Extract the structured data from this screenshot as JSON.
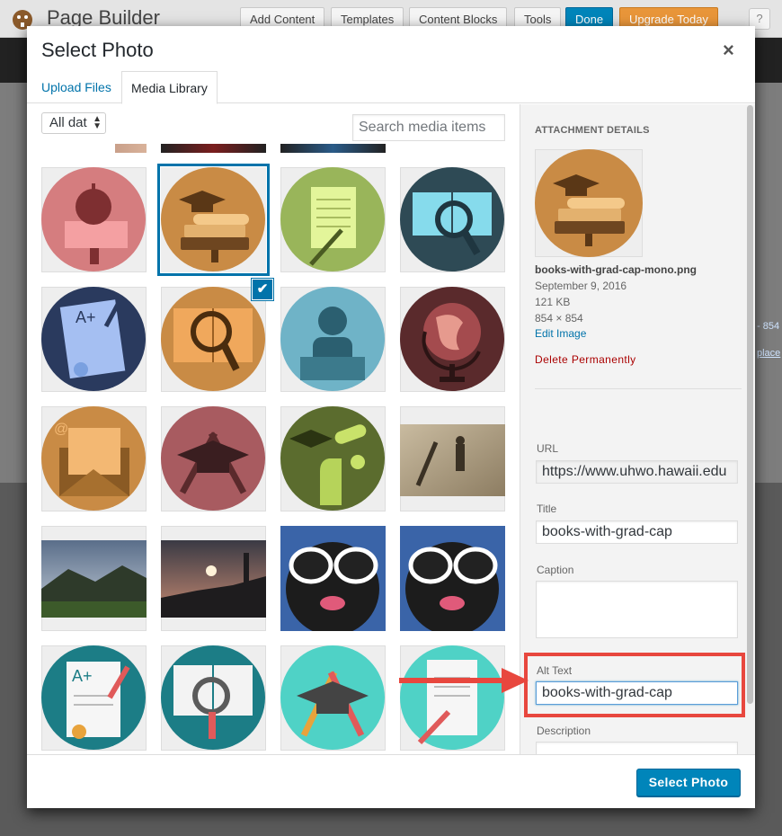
{
  "page_builder": {
    "title": "Page Builder",
    "buttons": [
      "Add Content",
      "Templates",
      "Content Blocks",
      "Tools",
      "Done",
      "Upgrade Today"
    ],
    "help": "?"
  },
  "background": {
    "right_text_1": "- 854",
    "right_text_2": "place"
  },
  "modal": {
    "title": "Select Photo",
    "close": "×",
    "tabs": {
      "upload": "Upload Files",
      "library": "Media Library"
    }
  },
  "toolbar": {
    "date_filter": "All dat",
    "search_placeholder": "Search media items"
  },
  "media_items": [
    {
      "name": "apple-books",
      "selected": false
    },
    {
      "name": "books-with-grad-cap-mono",
      "selected": true
    },
    {
      "name": "paper-pencil",
      "selected": false
    },
    {
      "name": "open-book-magnifier",
      "selected": false
    },
    {
      "name": "a-plus-certificate",
      "selected": false
    },
    {
      "name": "book-magnifier-orange",
      "selected": false
    },
    {
      "name": "reader",
      "selected": false
    },
    {
      "name": "globe",
      "selected": false
    },
    {
      "name": "email-envelope",
      "selected": false
    },
    {
      "name": "grad-cap-pencils",
      "selected": false
    },
    {
      "name": "hand-diploma",
      "selected": false
    },
    {
      "name": "sand-shadow-photo",
      "selected": false
    },
    {
      "name": "mountain-clouds-photo",
      "selected": false
    },
    {
      "name": "sunset-photo",
      "selected": false
    },
    {
      "name": "dog-sunglasses-photo",
      "selected": false
    },
    {
      "name": "dog-sunglasses-photo-2",
      "selected": false
    },
    {
      "name": "a-plus-paper",
      "selected": false
    },
    {
      "name": "open-book-magnifier-teal",
      "selected": false
    },
    {
      "name": "grad-cap-pencils-teal",
      "selected": false
    },
    {
      "name": "paper-pencil-teal",
      "selected": false
    }
  ],
  "attachment": {
    "heading": "Attachment Details",
    "filename": "books-with-grad-cap-mono.png",
    "date": "September 9, 2016",
    "size": "121 KB",
    "dimensions": "854 × 854",
    "edit": "Edit Image",
    "delete": "Delete Permanently",
    "url_label": "URL",
    "url": "https://www.uhwo.hawaii.edu",
    "title_label": "Title",
    "title": "books-with-grad-cap",
    "caption_label": "Caption",
    "caption": "",
    "alt_label": "Alt Text",
    "alt": "books-with-grad-cap",
    "description_label": "Description",
    "description": ""
  },
  "footer": {
    "select_button": "Select Photo"
  },
  "colors": {
    "primary": "#0085ba",
    "link": "#0073aa",
    "highlight": "#e8473e",
    "delete": "#aa0000"
  }
}
